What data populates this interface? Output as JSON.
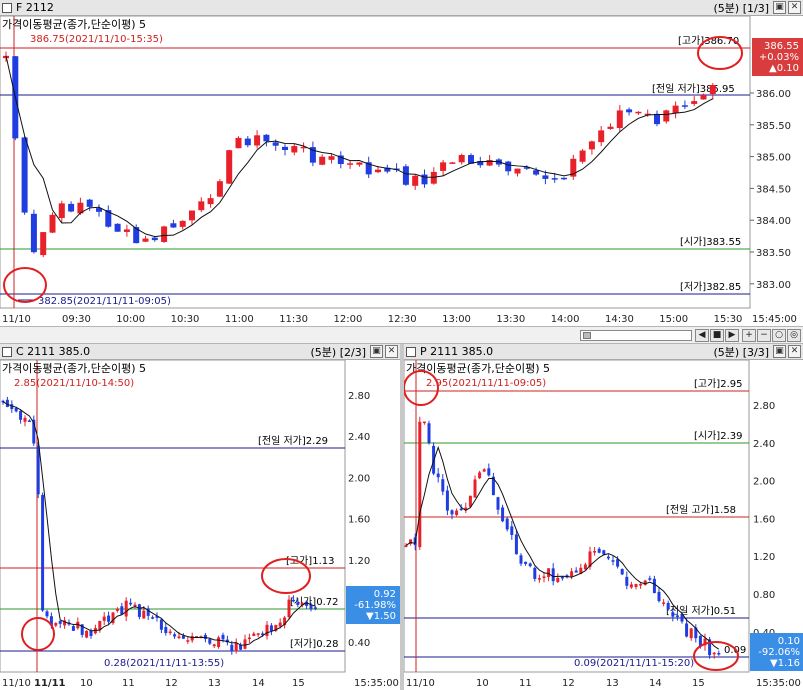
{
  "main": {
    "symbol": "F 2112",
    "period_info": "(5분) [1/3]",
    "indicator_label": "가격이동평균(종가,단순이평) 5",
    "high_marker": "386.75(2021/11/10-15:35)",
    "low_marker": "382.85(2021/11/11-09:05)",
    "y_ticks": [
      "386.00",
      "385.50",
      "385.00",
      "384.50",
      "384.00",
      "383.50",
      "383.00"
    ],
    "x_ticks": [
      "11/10",
      "09:30",
      "10:00",
      "10:30",
      "11:00",
      "11:30",
      "12:00",
      "12:30",
      "13:00",
      "13:30",
      "14:00",
      "14:30",
      "15:00",
      "15:30",
      "15:45:00"
    ],
    "ref_lines": {
      "high": "[고가]386.70",
      "prev_low": "[전일 저가]385.95",
      "open": "[시가]383.55",
      "low": "[저가]382.85"
    },
    "price_box": [
      "386.55",
      "+0.03%",
      "▲0.10"
    ],
    "colors": {
      "up": "#e8202a",
      "down": "#1f3de0",
      "box": "#d83c3c"
    }
  },
  "call": {
    "symbol": "C 2111 385.0",
    "period_info": "(5분) [2/3]",
    "indicator_label": "가격이동평균(종가,단순이평) 5",
    "high_marker": "2.85(2021/11/10-14:50)",
    "low_marker": "0.28(2021/11/11-13:55)",
    "y_ticks": [
      "2.80",
      "2.40",
      "2.00",
      "1.60",
      "1.20",
      "0.80",
      "0.40"
    ],
    "x_ticks": [
      "11/10",
      "11/11",
      "10",
      "11",
      "12",
      "13",
      "14",
      "15",
      "15:35:00"
    ],
    "ref_lines": {
      "prev_low": "[전일 저가]2.29",
      "high": "[고가]1.13",
      "open": "[시가]0.72",
      "low": "[저가]0.28"
    },
    "price_box": [
      "0.92",
      "-61.98%",
      "▼1.50"
    ],
    "colors": {
      "box": "#3a8ee6"
    }
  },
  "put": {
    "symbol": "P 2111 385.0",
    "period_info": "(5분) [3/3]",
    "indicator_label": "가격이동평균(종가,단순이평) 5",
    "high_marker": "2.95(2021/11/11-09:05)",
    "low_marker": "0.09(2021/11/11-15:20)",
    "y_ticks": [
      "2.80",
      "2.40",
      "2.00",
      "1.60",
      "1.20",
      "0.80",
      "0.40"
    ],
    "x_ticks": [
      "11/10",
      "10",
      "11",
      "12",
      "13",
      "14",
      "15",
      "15:35:00"
    ],
    "ref_lines": {
      "high": "[고가]2.95",
      "open": "[시가]2.39",
      "prev_high": "[전일 고가]1.58",
      "prev_low": "[전일 저가]0.51",
      "low": "0.09"
    },
    "price_box": [
      "0.10",
      "-92.06%",
      "▼1.16"
    ],
    "colors": {
      "box": "#3a8ee6"
    }
  }
}
